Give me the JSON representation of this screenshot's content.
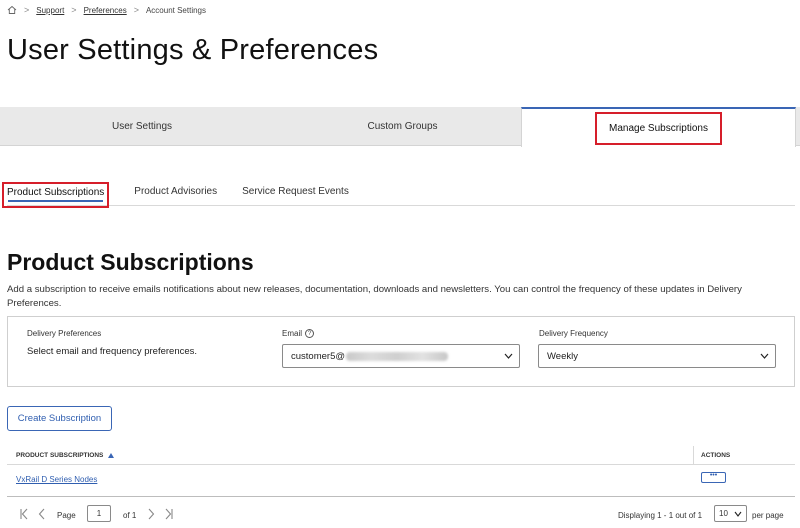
{
  "breadcrumb": {
    "home_icon": "home-icon",
    "items": [
      "Support",
      "Preferences",
      "Account Settings"
    ]
  },
  "page_title": "User Settings & Preferences",
  "main_tabs": [
    "User Settings",
    "Custom Groups",
    "Manage Subscriptions"
  ],
  "active_main_tab": "Manage Subscriptions",
  "sub_tabs": [
    "Product Subscriptions",
    "Product Advisories",
    "Service Request Events"
  ],
  "active_sub_tab": "Product Subscriptions",
  "section": {
    "title": "Product Subscriptions",
    "description": "Add a subscription to receive emails notifications about new releases, documentation, downloads and newsletters. You can control the frequency of these updates in Delivery Preferences."
  },
  "preferences": {
    "delivery_label": "Delivery Preferences",
    "delivery_text": "Select email and frequency preferences.",
    "email_label": "Email",
    "email_value_prefix": "customer5@",
    "frequency_label": "Delivery Frequency",
    "frequency_value": "Weekly"
  },
  "create_button": "Create Subscription",
  "table": {
    "col_name": "PRODUCT SUBSCRIPTIONS",
    "col_actions": "ACTIONS",
    "rows": [
      {
        "name": "VxRail D Series Nodes",
        "action": "•••"
      }
    ]
  },
  "pager": {
    "page_label": "Page",
    "page_value": "1",
    "of_label": "of 1",
    "display_text": "Displaying 1 - 1 out of 1",
    "per_page_value": "10",
    "per_page_label": "per page"
  },
  "colors": {
    "accent": "#3a66b5",
    "highlight": "#d61e2a",
    "tab_bg": "#e9e9e9"
  }
}
